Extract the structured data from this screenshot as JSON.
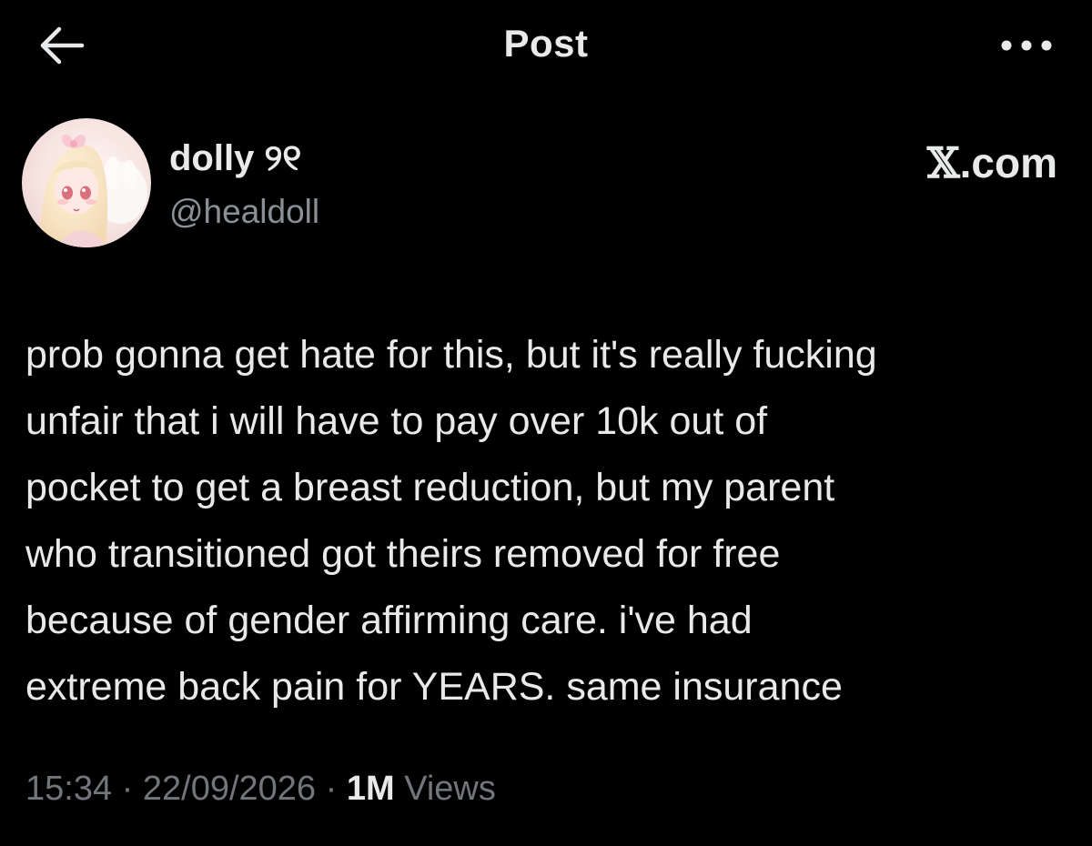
{
  "header": {
    "title": "Post",
    "back_icon": "arrow-left-icon",
    "more_icon": "more-horizontal-icon"
  },
  "author": {
    "display_name": "dolly ୨୧",
    "handle": "@healdoll",
    "avatar_icon": "avatar-image"
  },
  "site_mark": {
    "x": "𝕏",
    "suffix": ".com"
  },
  "post": {
    "lines": [
      "prob gonna get hate for this, but it's really fucking",
      "unfair that i will have to pay over 10k out of",
      "pocket to get a breast reduction, but my parent",
      "who transitioned got theirs removed for free",
      "because of gender affirming care. i've had",
      "extreme back pain for YEARS. same insurance"
    ]
  },
  "meta": {
    "time": "15:34",
    "date": "22/09/2026",
    "separator": " · ",
    "views_count": "1M",
    "views_label": " Views"
  },
  "colors": {
    "background": "#000000",
    "text_primary": "#e7e9ea",
    "text_secondary": "#8b9097",
    "text_meta": "#72767b"
  }
}
